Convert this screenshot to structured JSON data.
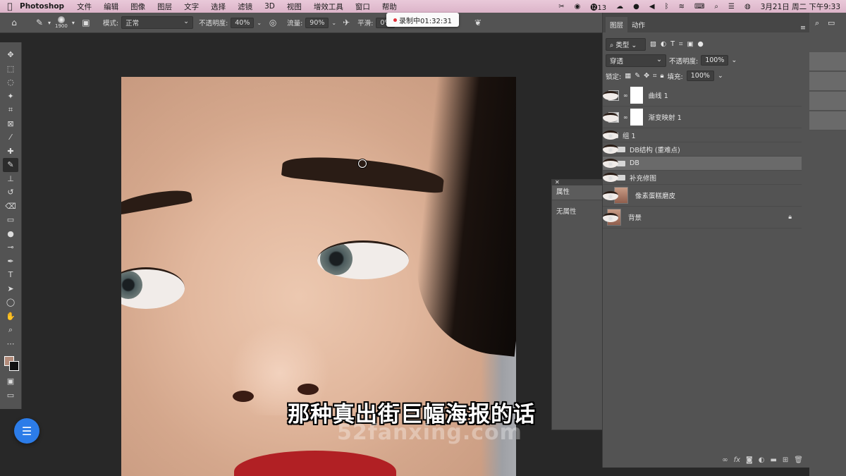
{
  "menubar": {
    "app_name": "Photoshop",
    "items": [
      "文件",
      "编辑",
      "图像",
      "图层",
      "文字",
      "选择",
      "滤镜",
      "3D",
      "视图",
      "增效工具",
      "窗口",
      "帮助"
    ],
    "status_badge": "13",
    "datetime": "3月21日 周二 下午9:33"
  },
  "options": {
    "brush_size": "1900",
    "mode_label": "模式:",
    "mode_value": "正常",
    "opacity_label": "不透明度:",
    "opacity_value": "40%",
    "flow_label": "流量:",
    "flow_value": "90%",
    "smooth_label": "平滑:",
    "smooth_value": "0%"
  },
  "recording": {
    "text": "录制中01:32:31"
  },
  "properties": {
    "tab": "属性",
    "content": "无属性"
  },
  "layers_panel": {
    "tabs": [
      "图层",
      "动作"
    ],
    "filter_label": "类型",
    "blend_mode": "穿透",
    "opacity_label": "不透明度:",
    "opacity_value": "100%",
    "lock_label": "锁定:",
    "fill_label": "填充:",
    "fill_value": "100%",
    "layers": [
      {
        "name": "曲线 1"
      },
      {
        "name": "渐变映射 1"
      },
      {
        "name": "组 1"
      },
      {
        "name": "DB结构 (重难点)"
      },
      {
        "name": "DB"
      },
      {
        "name": "补充修图"
      },
      {
        "name": "像素蛋糕磨皮"
      },
      {
        "name": "背景"
      }
    ]
  },
  "subtitle": "那种真出街巨幅海报的话",
  "watermark": "52fanxing.com",
  "colors": {
    "foreground": "#b28b7a",
    "background": "#111111",
    "accent": "#2c7ce8"
  }
}
